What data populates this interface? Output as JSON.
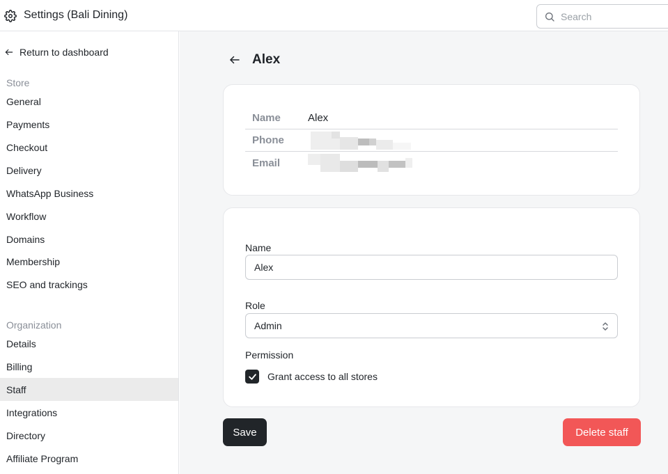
{
  "header": {
    "title": "Settings (Bali Dining)",
    "search_placeholder": "Search"
  },
  "sidebar": {
    "back_label": "Return to dashboard",
    "store_label": "Store",
    "store_items": [
      "General",
      "Payments",
      "Checkout",
      "Delivery",
      "WhatsApp Business",
      "Workflow",
      "Domains",
      "Membership",
      "SEO and trackings"
    ],
    "org_label": "Organization",
    "org_items": [
      "Details",
      "Billing",
      "Staff",
      "Integrations",
      "Directory",
      "Affiliate Program"
    ],
    "active_item": "Staff"
  },
  "page": {
    "title": "Alex"
  },
  "info": {
    "name_key": "Name",
    "name_value": "Alex",
    "phone_key": "Phone",
    "email_key": "Email"
  },
  "form": {
    "name_label": "Name",
    "name_value": "Alex",
    "role_label": "Role",
    "role_value": "Admin",
    "permission_label": "Permission",
    "grant_all_label": "Grant access to all stores",
    "grant_all_checked": true
  },
  "actions": {
    "save_label": "Save",
    "delete_label": "Delete staff"
  },
  "colors": {
    "primary": "#212529",
    "danger": "#f25757",
    "active_nav": "#ebebeb",
    "main_bg": "#f5f6f7"
  }
}
